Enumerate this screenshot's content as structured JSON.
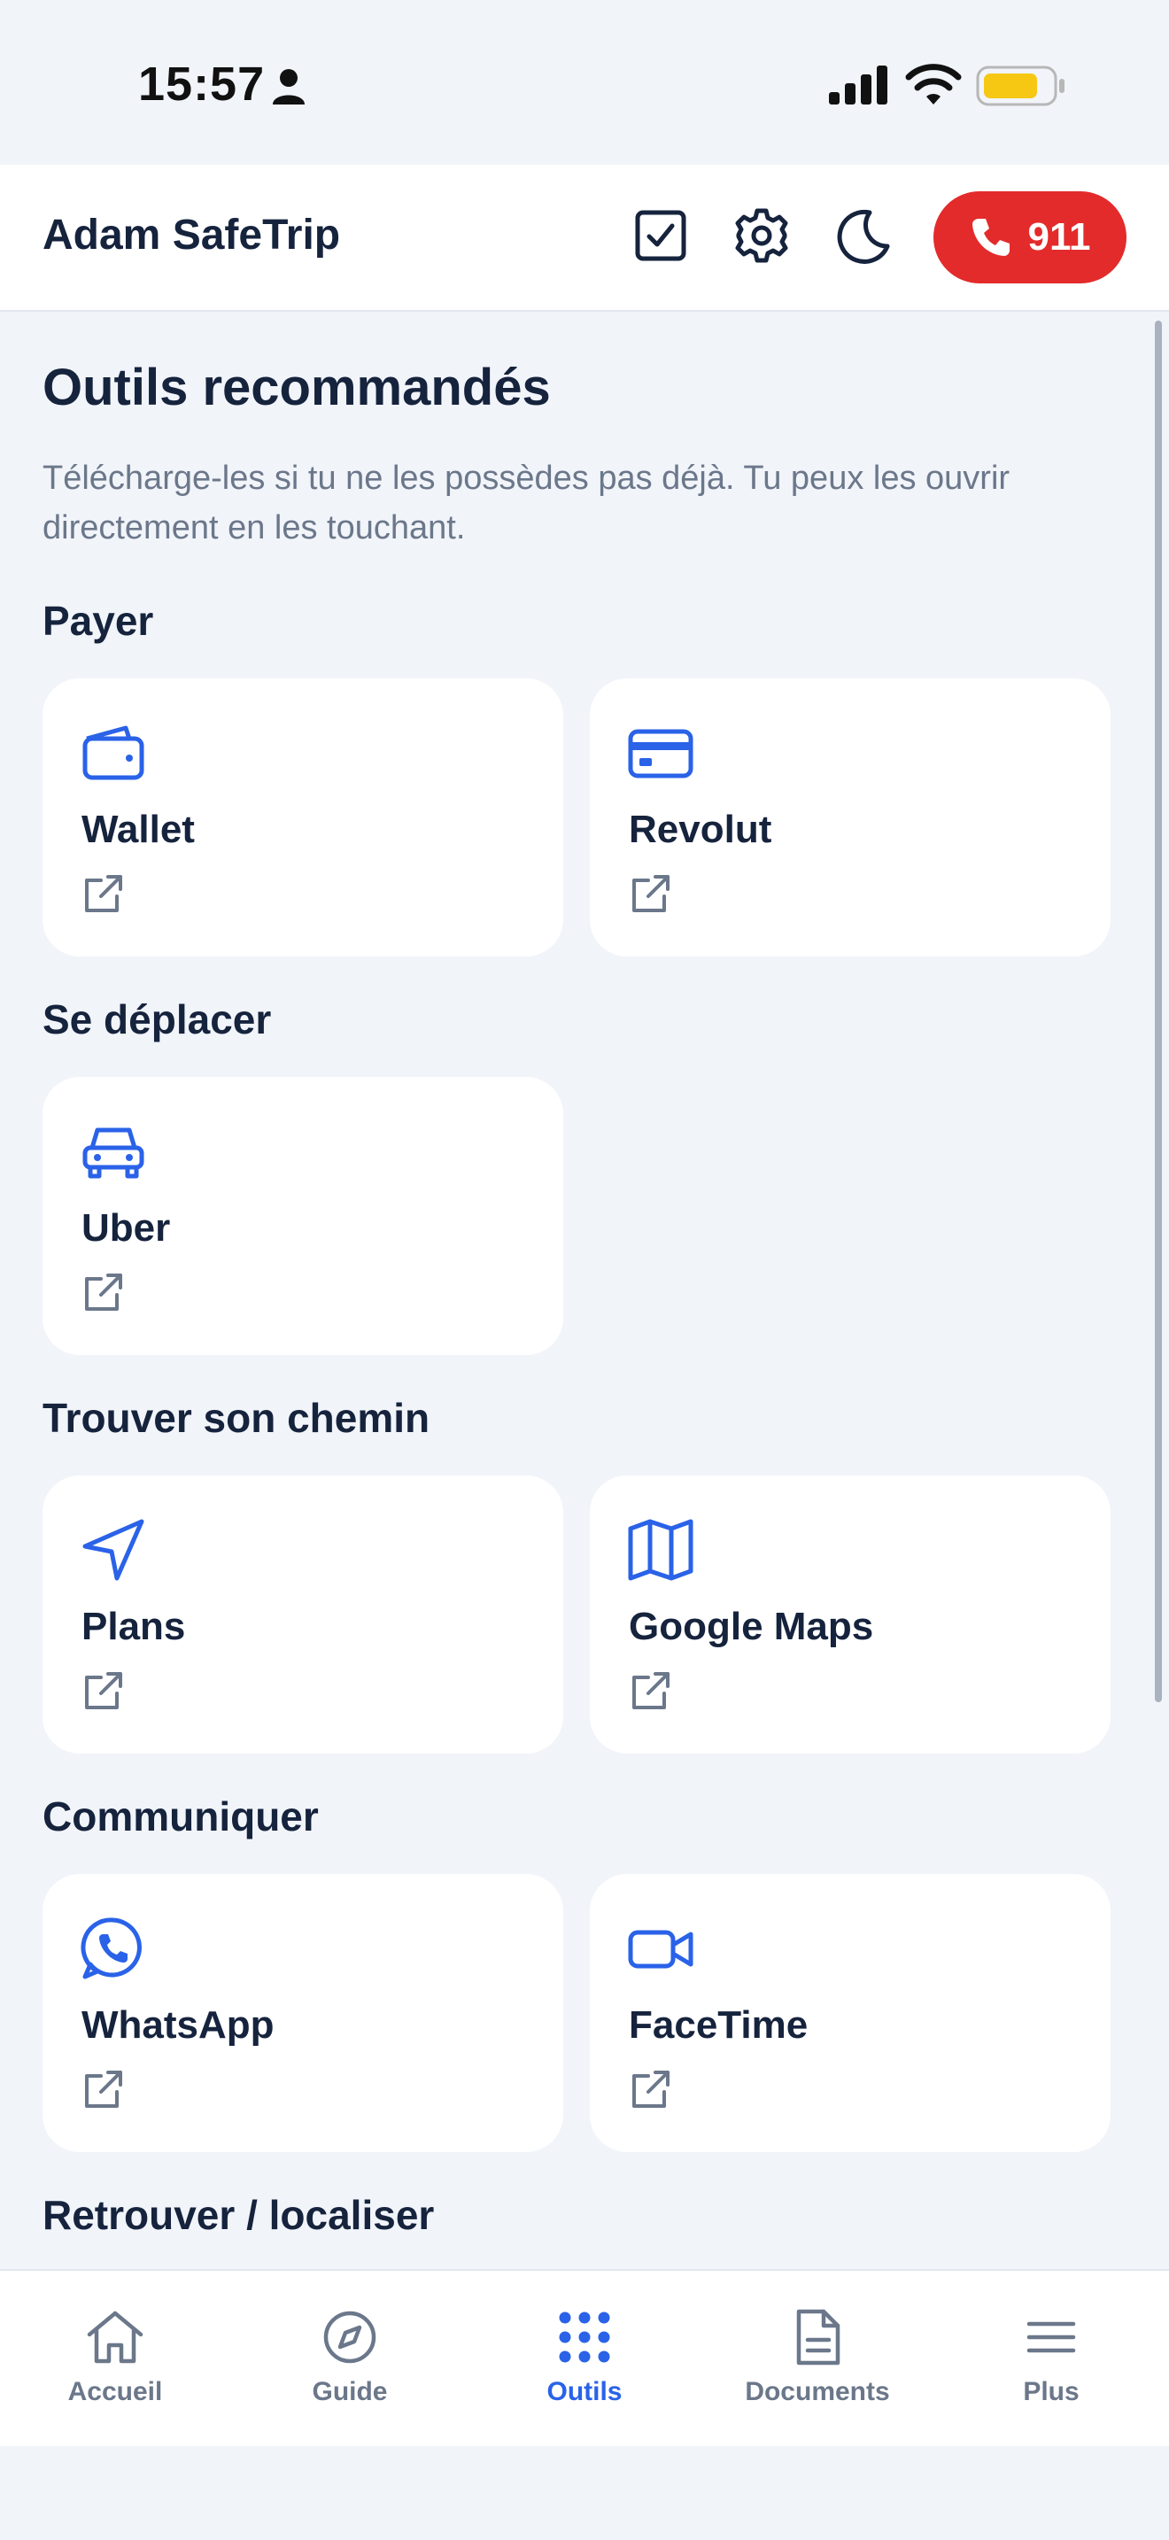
{
  "status_bar": {
    "time": "15:57"
  },
  "header": {
    "title": "Adam SafeTrip",
    "emergency_label": "911"
  },
  "main": {
    "title": "Outils recommandés",
    "subtitle": "Télécharge-les si tu ne les possèdes pas déjà. Tu peux les ouvrir directement en les touchant.",
    "sections": [
      {
        "title": "Payer",
        "apps": [
          {
            "name": "Wallet",
            "icon": "wallet-icon"
          },
          {
            "name": "Revolut",
            "icon": "credit-card-icon"
          }
        ]
      },
      {
        "title": "Se déplacer",
        "apps": [
          {
            "name": "Uber",
            "icon": "car-icon"
          }
        ]
      },
      {
        "title": "Trouver son chemin",
        "apps": [
          {
            "name": "Plans",
            "icon": "navigation-arrow-icon"
          },
          {
            "name": "Google Maps",
            "icon": "map-icon"
          }
        ]
      },
      {
        "title": "Communiquer",
        "apps": [
          {
            "name": "WhatsApp",
            "icon": "whatsapp-icon"
          },
          {
            "name": "FaceTime",
            "icon": "video-camera-icon"
          }
        ]
      },
      {
        "title": "Retrouver / localiser",
        "apps": []
      }
    ]
  },
  "tabbar": {
    "items": [
      {
        "label": "Accueil",
        "icon": "home-icon",
        "active": false
      },
      {
        "label": "Guide",
        "icon": "compass-icon",
        "active": false
      },
      {
        "label": "Outils",
        "icon": "grid-dots-icon",
        "active": true
      },
      {
        "label": "Documents",
        "icon": "document-icon",
        "active": false
      },
      {
        "label": "Plus",
        "icon": "menu-icon",
        "active": false
      }
    ]
  },
  "colors": {
    "accent": "#2a62e8",
    "emergency": "#e32b2b",
    "background": "#f1f4f9",
    "text": "#16233d",
    "muted": "#6b778a"
  }
}
